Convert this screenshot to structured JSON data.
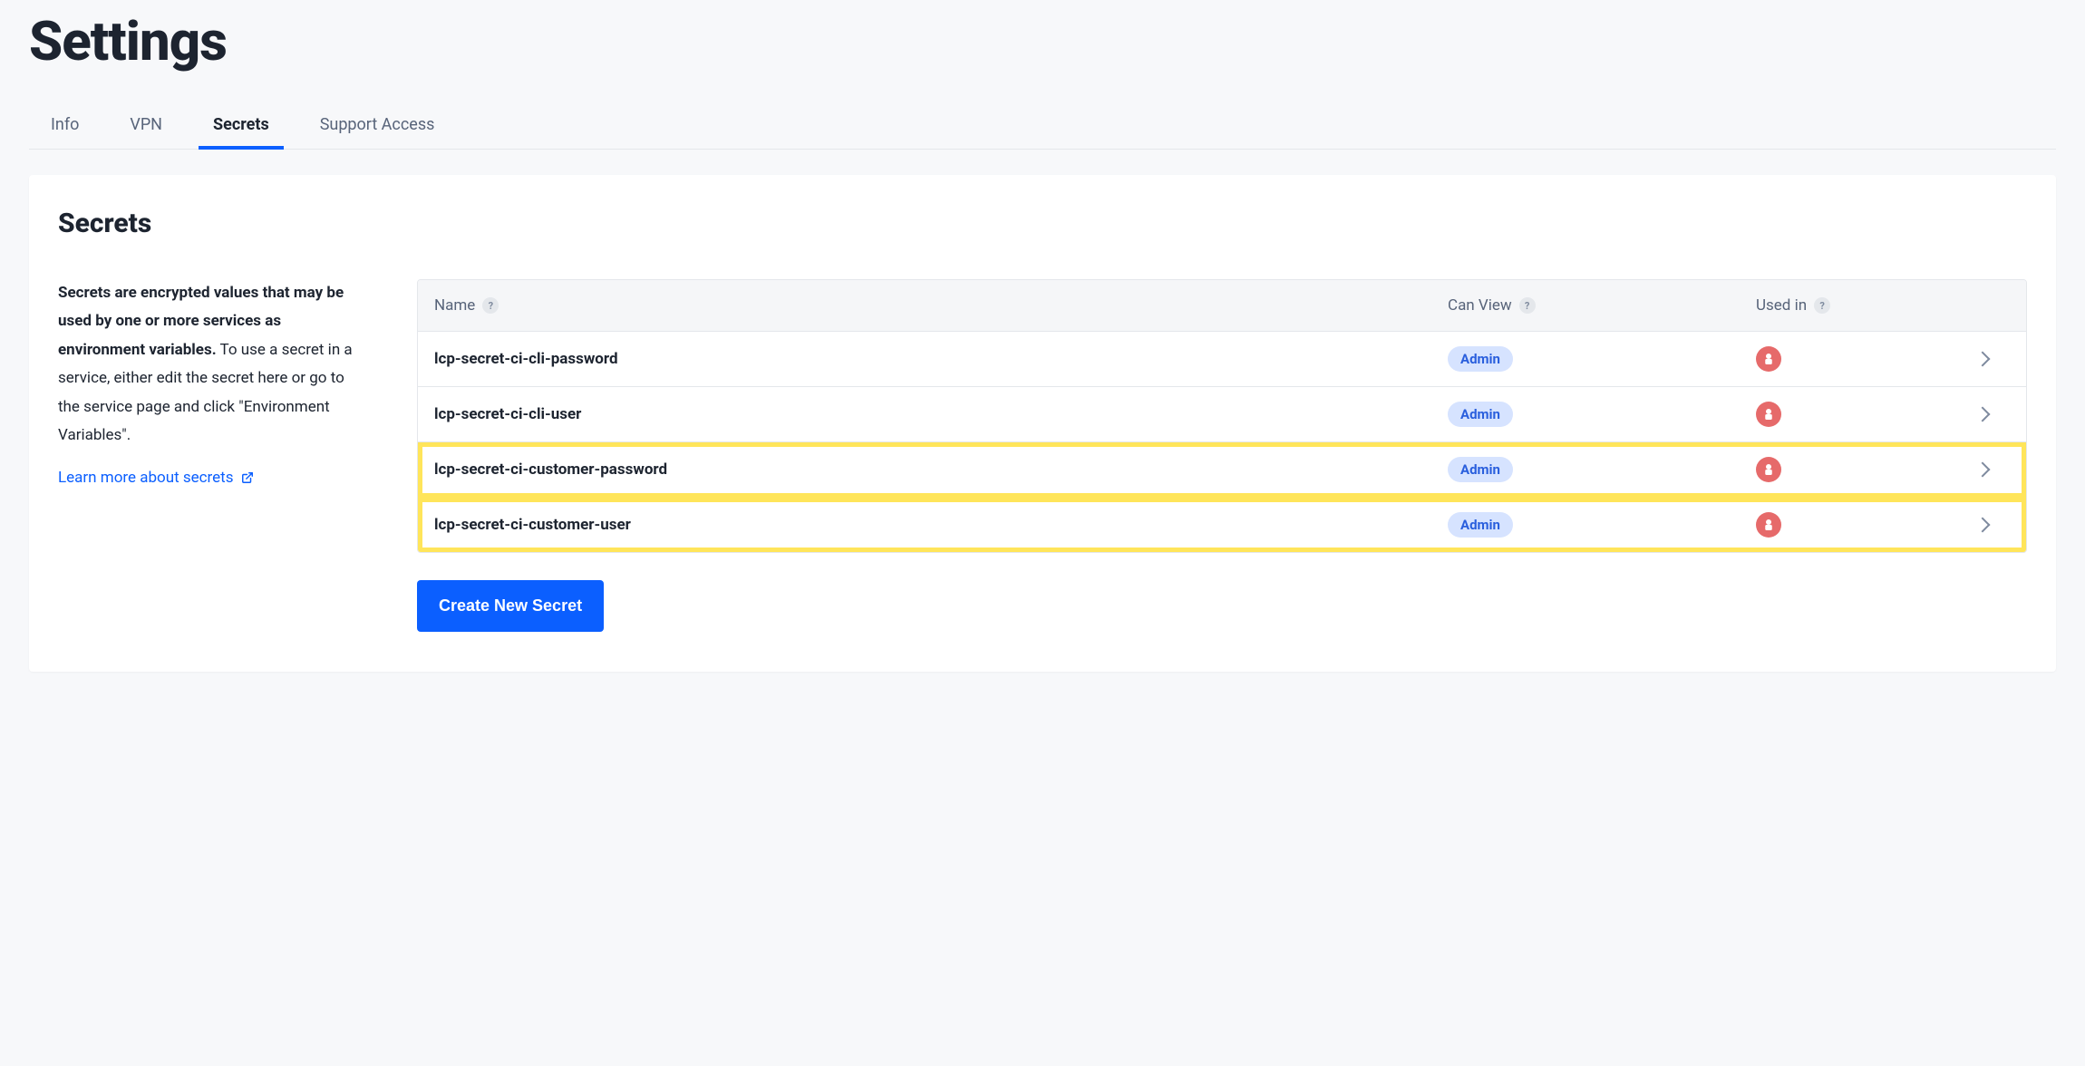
{
  "header": {
    "title": "Settings"
  },
  "tabs": [
    {
      "label": "Info",
      "active": false
    },
    {
      "label": "VPN",
      "active": false
    },
    {
      "label": "Secrets",
      "active": true
    },
    {
      "label": "Support Access",
      "active": false
    }
  ],
  "section": {
    "title": "Secrets",
    "description_bold": "Secrets are encrypted values that may be used by one or more services as environment variables.",
    "description_rest": " To use a secret in a service, either edit the secret here or go to the service page and click \"Environment Variables\".",
    "learn_more_label": "Learn more about secrets"
  },
  "table": {
    "columns": {
      "name": "Name",
      "can_view": "Can View",
      "used_in": "Used in"
    },
    "rows": [
      {
        "name": "lcp-secret-ci-cli-password",
        "can_view": "Admin",
        "used_in_icon": "ci-service",
        "highlighted": false
      },
      {
        "name": "lcp-secret-ci-cli-user",
        "can_view": "Admin",
        "used_in_icon": "ci-service",
        "highlighted": false
      },
      {
        "name": "lcp-secret-ci-customer-password",
        "can_view": "Admin",
        "used_in_icon": "ci-service",
        "highlighted": true
      },
      {
        "name": "lcp-secret-ci-customer-user",
        "can_view": "Admin",
        "used_in_icon": "ci-service",
        "highlighted": true
      }
    ],
    "create_label": "Create New Secret"
  }
}
